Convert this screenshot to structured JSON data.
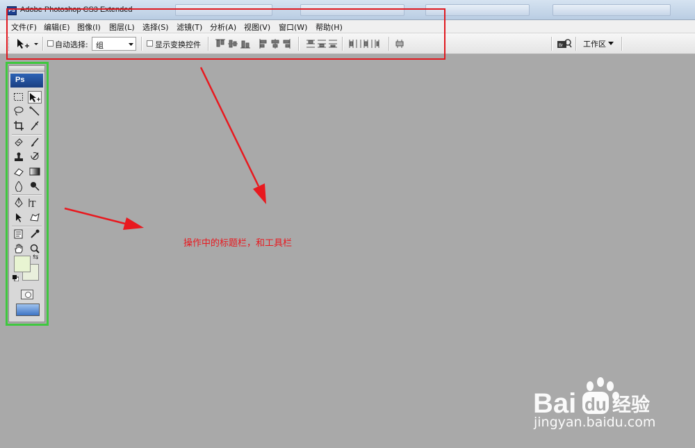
{
  "window": {
    "title": "Adobe Photoshop CS3 Extended",
    "app_icon_text": "PS"
  },
  "menu": [
    "文件(F)",
    "编辑(E)",
    "图像(I)",
    "图层(L)",
    "选择(S)",
    "滤镜(T)",
    "分析(A)",
    "视图(V)",
    "窗口(W)",
    "帮助(H)"
  ],
  "options_bar": {
    "auto_select_label": "自动选择:",
    "auto_select_checked": false,
    "group_value": "组",
    "show_transform_label": "显示变换控件",
    "show_transform_checked": false,
    "workspace_label": "工作区"
  },
  "toolbox": {
    "logo_text": "Ps",
    "foreground_color": "#e8f4d2",
    "background_color": "#e9efdc"
  },
  "annotation": {
    "text": "操作中的标题栏，和工具栏",
    "color": "#e8191f",
    "highlight_colors": {
      "titlebar_box": "#e0181e",
      "toolbox_box": "#3fc83f"
    }
  },
  "watermark": {
    "logo_text": "Baidu经验",
    "url": "jingyan.baidu.com"
  }
}
